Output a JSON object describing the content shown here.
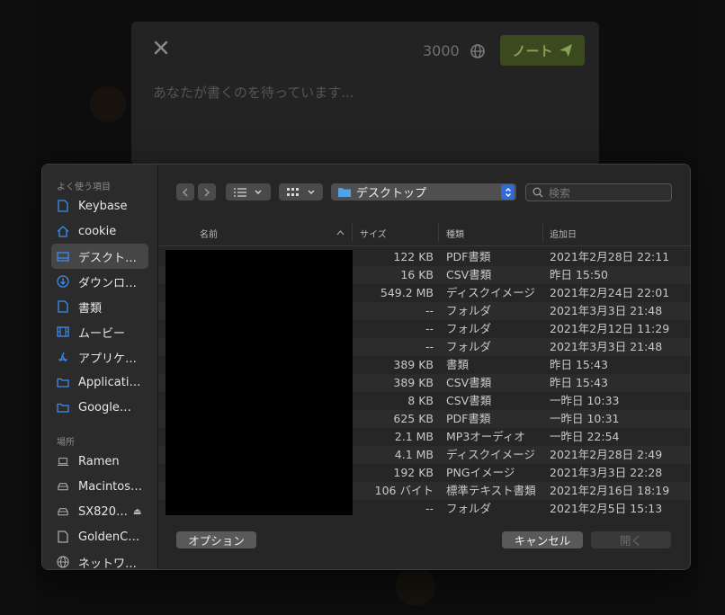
{
  "compose": {
    "char_count": "3000",
    "note_button_label": "ノート",
    "placeholder": "あなたが書くのを待っています..."
  },
  "dialog": {
    "sidebar": {
      "favorites_header": "よく使う項目",
      "favorites": [
        {
          "label": "Keybase",
          "icon": "document-icon"
        },
        {
          "label": "cookie",
          "icon": "home-icon"
        },
        {
          "label": "デスクト…",
          "icon": "desktop-icon"
        },
        {
          "label": "ダウンロ…",
          "icon": "download-icon"
        },
        {
          "label": "書類",
          "icon": "document-icon"
        },
        {
          "label": "ムービー",
          "icon": "film-icon"
        },
        {
          "label": "アプリケ…",
          "icon": "applications-icon"
        },
        {
          "label": "Applicati…",
          "icon": "folder-icon"
        },
        {
          "label": "Google…",
          "icon": "folder-icon"
        }
      ],
      "locations_header": "場所",
      "locations": [
        {
          "label": "Ramen",
          "icon": "laptop-icon"
        },
        {
          "label": "Macintos…",
          "icon": "drive-icon"
        },
        {
          "label": "SX820…",
          "icon": "drive-icon",
          "eject": "⏏"
        },
        {
          "label": "GoldenC…",
          "icon": "document-icon"
        },
        {
          "label": "ネットワ…",
          "icon": "network-icon"
        }
      ]
    },
    "toolbar": {
      "path": "デスクトップ",
      "search_placeholder": "検索"
    },
    "columns": {
      "name": "名前",
      "size": "サイズ",
      "kind": "種類",
      "date_added": "追加日"
    },
    "files": [
      {
        "size": "122 KB",
        "kind": "PDF書類",
        "date": "2021年2月28日 22:11"
      },
      {
        "size": "16 KB",
        "kind": "CSV書類",
        "date": "昨日 15:50"
      },
      {
        "size": "549.2 MB",
        "kind": "ディスクイメージ",
        "date": "2021年2月24日 22:01"
      },
      {
        "size": "--",
        "kind": "フォルダ",
        "date": "2021年3月3日 21:48"
      },
      {
        "size": "--",
        "kind": "フォルダ",
        "date": "2021年2月12日 11:29"
      },
      {
        "size": "--",
        "kind": "フォルダ",
        "date": "2021年3月3日 21:48"
      },
      {
        "size": "389 KB",
        "kind": "書類",
        "date": "昨日 15:43"
      },
      {
        "size": "389 KB",
        "kind": "CSV書類",
        "date": "昨日 15:43"
      },
      {
        "size": "8 KB",
        "kind": "CSV書類",
        "date": "一昨日 10:33"
      },
      {
        "size": "625 KB",
        "kind": "PDF書類",
        "date": "一昨日 10:31"
      },
      {
        "size": "2.1 MB",
        "kind": "MP3オーディオ",
        "date": "一昨日 22:54"
      },
      {
        "size": "4.1 MB",
        "kind": "ディスクイメージ",
        "date": "2021年2月28日 2:49"
      },
      {
        "size": "192 KB",
        "kind": "PNGイメージ",
        "date": "2021年3月3日 22:28"
      },
      {
        "size": "106 バイト",
        "kind": "標準テキスト書類",
        "date": "2021年2月16日 18:19"
      },
      {
        "size": "--",
        "kind": "フォルダ",
        "date": "2021年2月5日 15:13"
      }
    ],
    "footer": {
      "options": "オプション",
      "cancel": "キャンセル",
      "open": "開く"
    }
  },
  "colors": {
    "accent_blue": "#2f6ad8",
    "note_button_bg": "#3a4a1e",
    "note_button_text": "#88a052"
  }
}
